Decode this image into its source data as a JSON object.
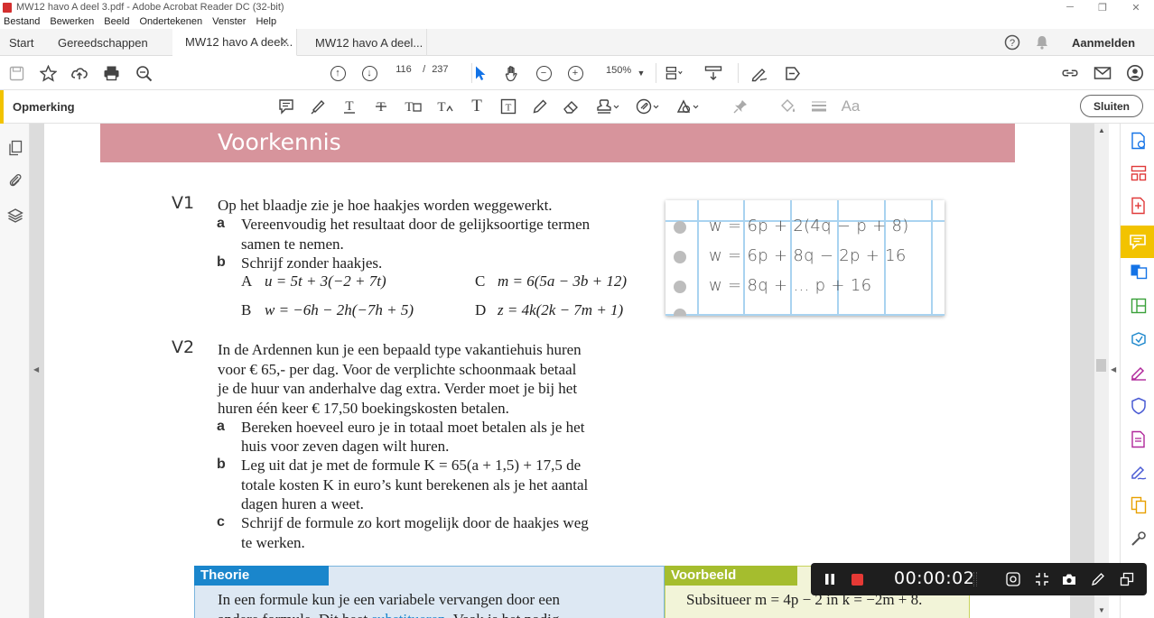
{
  "window": {
    "title": "MW12 havo A deel 3.pdf - Adobe Acrobat Reader DC (32-bit)",
    "minimize": "─",
    "maximize": "❐",
    "close": "✕"
  },
  "menu": [
    "Bestand",
    "Bewerken",
    "Beeld",
    "Ondertekenen",
    "Venster",
    "Help"
  ],
  "tabs": {
    "start": "Start",
    "tools": "Gereedschappen",
    "doc1": "MW12 havo A deel...",
    "doc2": "MW12 havo A deel...",
    "close_icon": "✕",
    "signin": "Aanmelden"
  },
  "toolbar": {
    "page_current": "116",
    "page_separator": "/",
    "page_total": "237",
    "zoom": "150%"
  },
  "comment_toolbar": {
    "label": "Opmerking",
    "close_label": "Sluiten",
    "text_tool": "T",
    "font_size": "Aa"
  },
  "document": {
    "banner_title": "Voorkennis",
    "v1": {
      "num": "V1",
      "intro": "Op het blaadje zie je hoe haakjes worden weggewerkt.",
      "a_label": "a",
      "a_line1": "Vereenvoudig het resultaat door de gelijksoortige termen",
      "a_line2": "samen te nemen.",
      "b_label": "b",
      "b_text": "Schrijf zonder haakjes.",
      "A": "A",
      "A_eq": "u = 5t + 3(−2 + 7t)",
      "B": "B",
      "B_eq": "w = −6h − 2h(−7h + 5)",
      "C": "C",
      "C_eq": "m = 6(5a − 3b + 12)",
      "D": "D",
      "D_eq": "z = 4k(2k − 7m + 1)"
    },
    "notepad": {
      "line1": "w = 6p + 2(4q − p + 8)",
      "line2": "w = 6p + 8q − 2p + 16",
      "line3": "w = 8q + … p + 16"
    },
    "v2": {
      "num": "V2",
      "l1": "In de Ardennen kun je een bepaald type vakantiehuis huren",
      "l2": "voor € 65,- per dag. Voor de verplichte schoonmaak betaal",
      "l3": "je de huur van anderhalve dag extra. Verder moet je bij het",
      "l4": "huren één keer € 17,50 boekingskosten betalen.",
      "a_label": "a",
      "a_l1": "Bereken hoeveel euro je in totaal moet betalen als je het",
      "a_l2": "huis voor zeven dagen wilt huren.",
      "b_label": "b",
      "b_l1": "Leg uit dat je met de formule K = 65(a + 1,5) + 17,5 de",
      "b_l2": "totale kosten K in euro’s kunt berekenen als je het aantal",
      "b_l3": "dagen huren a weet.",
      "c_label": "c",
      "c_l1": "Schrijf de formule zo kort mogelijk door de haakjes weg",
      "c_l2": "te werken."
    },
    "theorie": {
      "head": "Theorie",
      "l1": "In een formule kun je een variabele vervangen door een",
      "l2_start": "andere formule. Dit heet ",
      "l2_link": "substitueren",
      "l2_end": ". Vaak is het nodig"
    },
    "voorbeeld": {
      "head": "Voorbeeld",
      "l1": "Subsitueer m = 4p − 2 in k = −2m + 8."
    }
  },
  "recorder": {
    "timer": "00:00:02"
  },
  "colors": {
    "accent_yellow": "#f2c300",
    "banner": "#d7949c",
    "theorie_blue": "#1a86cc",
    "voorbeeld_green": "#a5bd2e",
    "record_red": "#e53935"
  }
}
